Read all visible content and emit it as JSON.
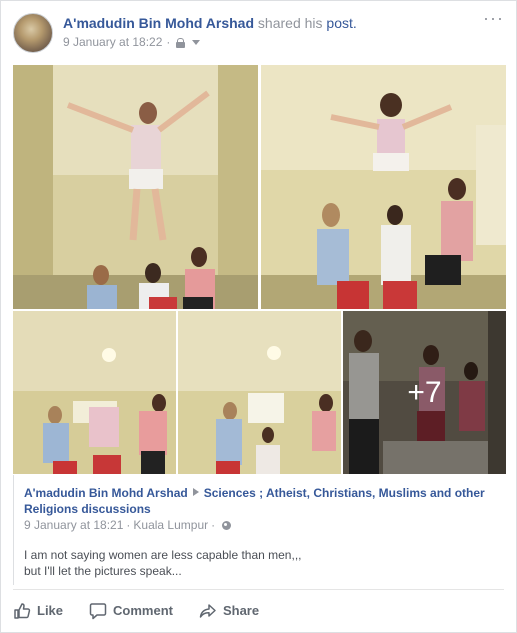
{
  "header": {
    "author": "A'madudin Bin Mohd Arshad",
    "shared_text": "shared his",
    "post_link": "post.",
    "date": "9 January at 18:22",
    "separator": "·",
    "more": "···"
  },
  "photos": {
    "more_count": "+7"
  },
  "shared_post": {
    "author": "A'madudin Bin Mohd Arshad",
    "group": "Sciences ; Atheist, Christians, Muslims and other Religions discussions",
    "date": "9 January at 18:21",
    "separator": "·",
    "location": "Kuala Lumpur",
    "separator2": "·",
    "text_line1": "I am not saying women are less capable than men,,,",
    "text_line2": "but I'll let the pictures speak..."
  },
  "actions": {
    "like": "Like",
    "comment": "Comment",
    "share": "Share"
  },
  "colors": {
    "link": "#365899",
    "muted": "#90949c",
    "action": "#606770"
  }
}
